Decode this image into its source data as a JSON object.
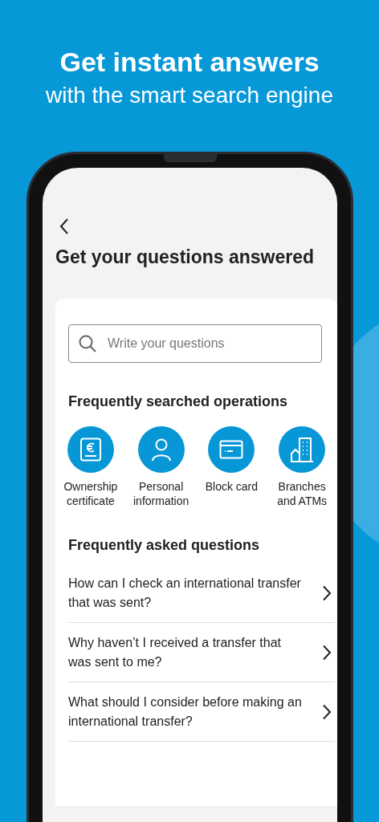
{
  "headline": {
    "title": "Get instant answers",
    "subtitle": "with the smart search engine"
  },
  "screen": {
    "title": "Get your questions answered",
    "search": {
      "placeholder": "Write your questions"
    },
    "operations_title": "Frequently searched operations",
    "operations": [
      {
        "kind": "certificate",
        "label": "Ownership certificate"
      },
      {
        "kind": "person",
        "label": "Personal information"
      },
      {
        "kind": "card",
        "label": "Block card"
      },
      {
        "kind": "building",
        "label": "Branches and ATMs"
      }
    ],
    "faq_title": "Frequently asked questions",
    "faq": [
      {
        "question": "How can I check an international transfer that was sent?"
      },
      {
        "question": "Why haven’t I received a transfer that was sent to me?"
      },
      {
        "question": "What should I consider before making an international transfer?"
      }
    ]
  }
}
